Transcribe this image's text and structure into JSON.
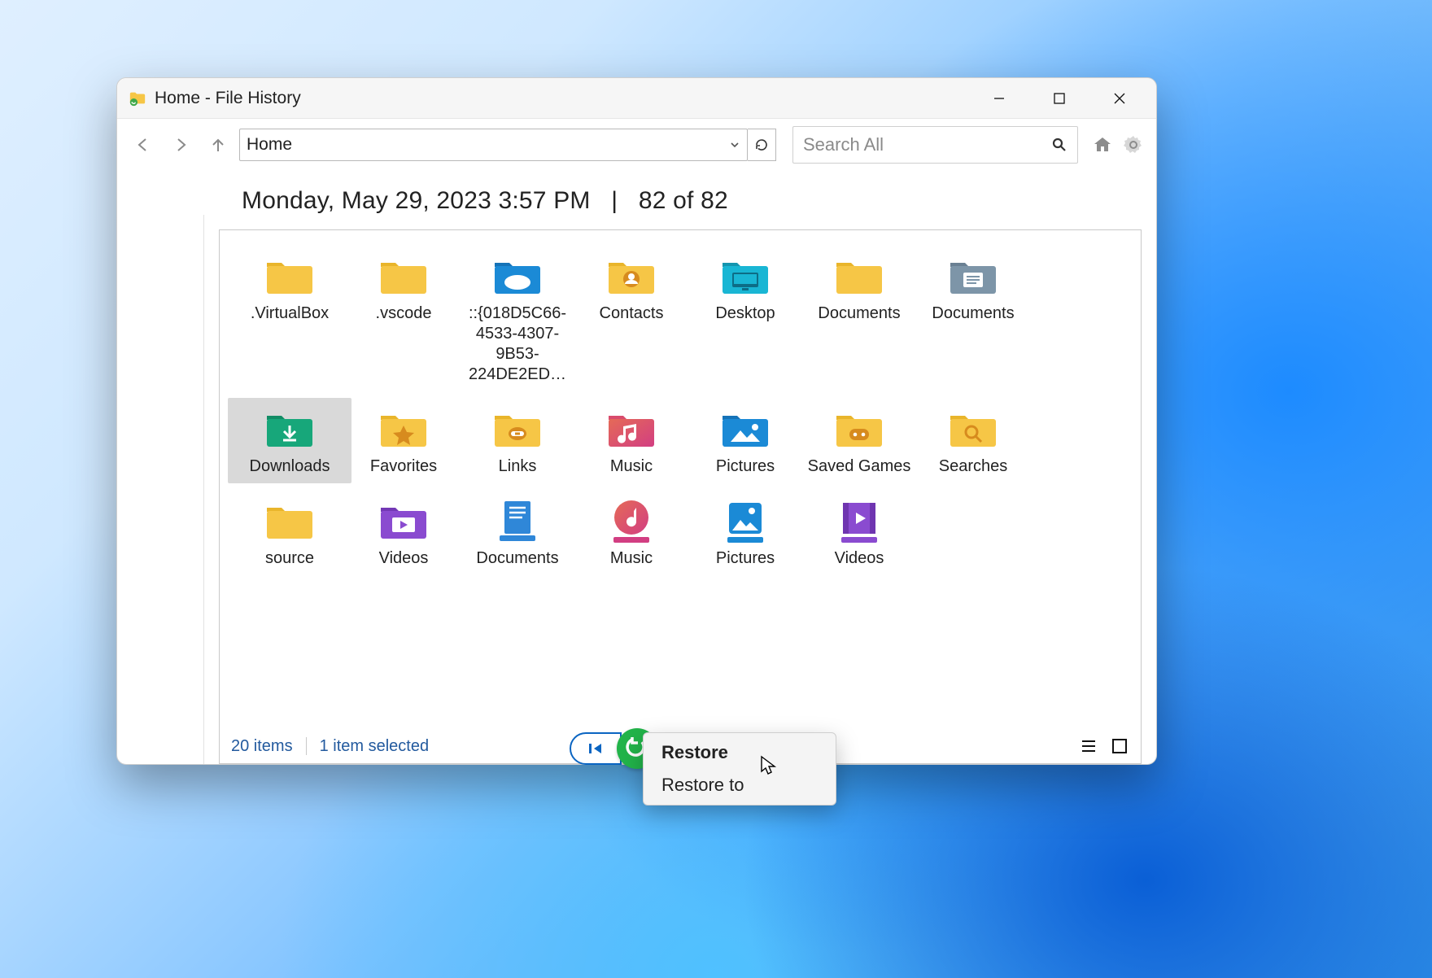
{
  "window": {
    "title": "Home - File History"
  },
  "toolbar": {
    "address": "Home",
    "search_placeholder": "Search All"
  },
  "timestamp": {
    "date": "Monday, May 29, 2023 3:57 PM",
    "separator": "|",
    "position": "82 of 82"
  },
  "items": [
    {
      "label": ".VirtualBox",
      "icon": "folder-yellow",
      "selected": false
    },
    {
      "label": ".vscode",
      "icon": "folder-yellow",
      "selected": false
    },
    {
      "label": "::{018D5C66-4533-4307-9B53-224DE2ED…",
      "icon": "folder-onedrive",
      "selected": false
    },
    {
      "label": "Contacts",
      "icon": "folder-contacts",
      "selected": false
    },
    {
      "label": "Desktop",
      "icon": "folder-desktop",
      "selected": false
    },
    {
      "label": "Documents",
      "icon": "folder-yellow",
      "selected": false
    },
    {
      "label": "Documents",
      "icon": "library-documents",
      "selected": false
    },
    {
      "label": "Downloads",
      "icon": "folder-downloads",
      "selected": true
    },
    {
      "label": "Favorites",
      "icon": "folder-favorites",
      "selected": false
    },
    {
      "label": "Links",
      "icon": "folder-links",
      "selected": false
    },
    {
      "label": "Music",
      "icon": "folder-music",
      "selected": false
    },
    {
      "label": "Pictures",
      "icon": "folder-pictures",
      "selected": false
    },
    {
      "label": "Saved Games",
      "icon": "folder-savedgames",
      "selected": false
    },
    {
      "label": "Searches",
      "icon": "folder-searches",
      "selected": false
    },
    {
      "label": "source",
      "icon": "folder-yellow",
      "selected": false
    },
    {
      "label": "Videos",
      "icon": "folder-videos",
      "selected": false
    },
    {
      "label": "Documents",
      "icon": "lib-doc-blue",
      "selected": false
    },
    {
      "label": "Music",
      "icon": "lib-music",
      "selected": false
    },
    {
      "label": "Pictures",
      "icon": "lib-pictures",
      "selected": false
    },
    {
      "label": "Videos",
      "icon": "lib-videos",
      "selected": false
    }
  ],
  "status": {
    "count": "20 items",
    "selection": "1 item selected"
  },
  "context_menu": {
    "restore": "Restore",
    "restore_to": "Restore to"
  }
}
